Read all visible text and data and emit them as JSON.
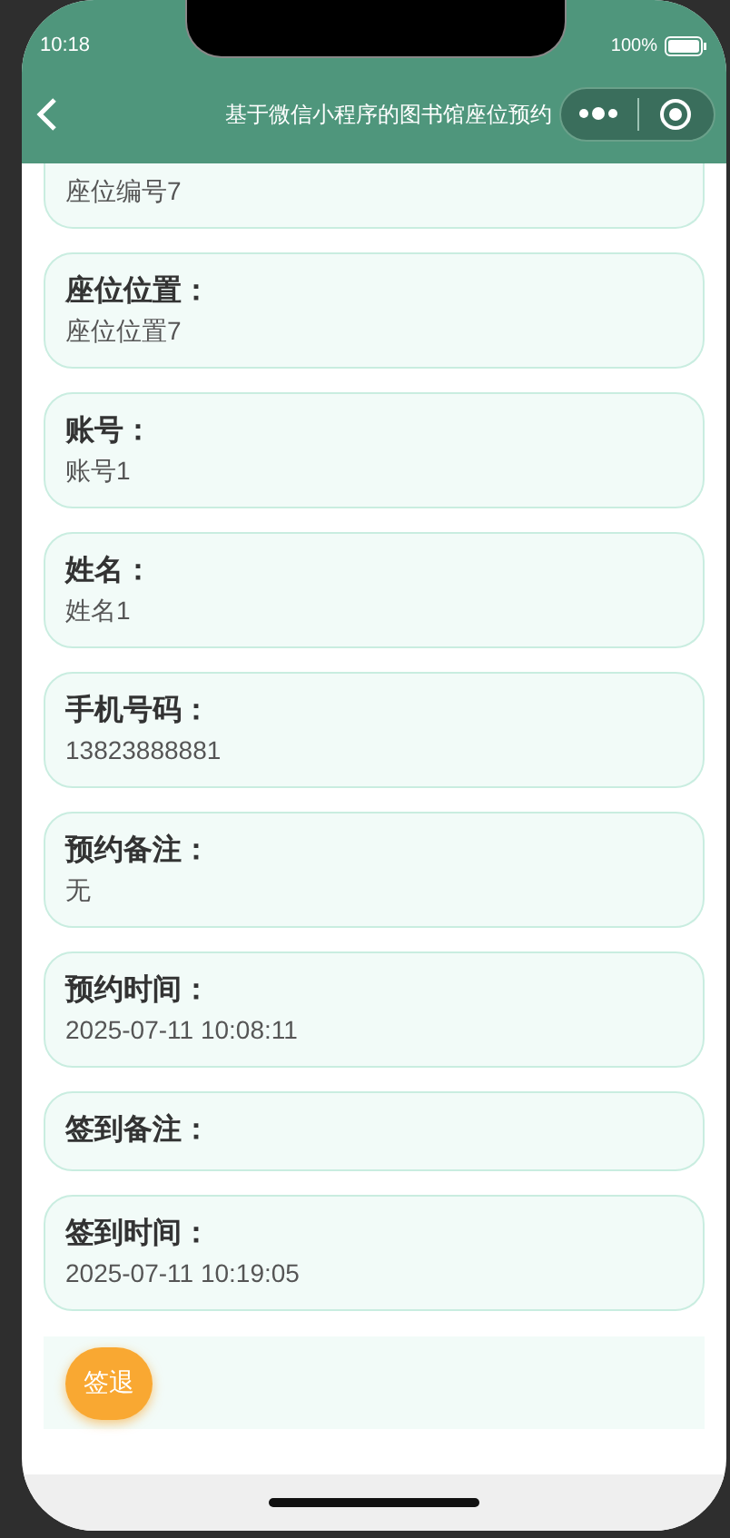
{
  "status_bar": {
    "time": "10:18",
    "battery": "100%"
  },
  "nav": {
    "title": "基于微信小程序的图书馆座位预约"
  },
  "fields": [
    {
      "kind": "partial",
      "value": "座位编号7"
    },
    {
      "kind": "full",
      "label": "座位位置：",
      "value": "座位位置7"
    },
    {
      "kind": "full",
      "label": "账号：",
      "value": "账号1"
    },
    {
      "kind": "full",
      "label": "姓名：",
      "value": "姓名1"
    },
    {
      "kind": "full",
      "label": "手机号码：",
      "value": "13823888881"
    },
    {
      "kind": "full",
      "label": "预约备注：",
      "value": "无"
    },
    {
      "kind": "full",
      "label": "预约时间：",
      "value": "2025-07-11 10:08:11"
    },
    {
      "kind": "full",
      "label": "签到备注："
    },
    {
      "kind": "full",
      "label": "签到时间：",
      "value": "2025-07-11 10:19:05"
    }
  ],
  "actions": [
    "签退"
  ]
}
